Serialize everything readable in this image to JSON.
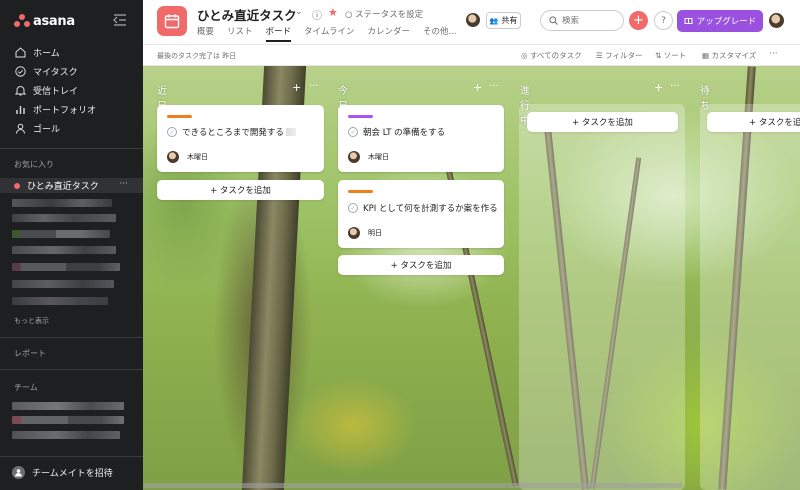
{
  "sidebar": {
    "logo_text": "asana",
    "nav": [
      {
        "label": "ホーム",
        "icon": "home-icon"
      },
      {
        "label": "マイタスク",
        "icon": "check-circle-icon"
      },
      {
        "label": "受信トレイ",
        "icon": "bell-icon"
      },
      {
        "label": "ポートフォリオ",
        "icon": "bar-chart-icon"
      },
      {
        "label": "ゴール",
        "icon": "person-icon"
      }
    ],
    "favorites_heading": "お気に入り",
    "favorite_item": "ひとみ直近タスク",
    "favorite_more": "···",
    "more_link": "もっと表示",
    "reports_heading": "レポート",
    "teams_heading": "チーム",
    "invite_label": "チームメイトを招待"
  },
  "header": {
    "project_title": "ひとみ直近タスク",
    "status": "ステータスを設定",
    "tabs": [
      "概要",
      "リスト",
      "ボード",
      "タイムライン",
      "カレンダー",
      "その他..."
    ],
    "active_tab": "ボード",
    "share": "共有",
    "search_placeholder": "検索",
    "help": "?",
    "upgrade": "アップグレード"
  },
  "subbar": {
    "last_completed": "最後のタスク完了は 昨日",
    "all_tasks": "すべてのタスク",
    "filter": "フィルター",
    "sort": "ソート",
    "customize": "カスタマイズ",
    "more": "···"
  },
  "board": {
    "add_task": "+ タスクを追加",
    "columns": [
      {
        "title": "近日やる",
        "cards": [
          {
            "title": "できるところまで開発する",
            "due": "木曜日",
            "bar_color": "#f27f1b"
          }
        ]
      },
      {
        "title": "今日やる",
        "cards": [
          {
            "title": "朝会 LT の準備をする",
            "due": "木曜日",
            "bar_color": "#a855f7"
          },
          {
            "title": "KPI として何を計測するか案を作る",
            "due": "明日",
            "bar_color": "#f27f1b"
          }
        ]
      },
      {
        "title": "進行中",
        "cards": []
      },
      {
        "title": "待ち",
        "cards": []
      }
    ]
  },
  "colors": {
    "sidebar_bg": "#1e1f21",
    "accent_coral": "#f06a6a",
    "upgrade_purple": "#9b51e0",
    "orange_tag": "#f27f1b",
    "purple_tag": "#a855f7"
  }
}
